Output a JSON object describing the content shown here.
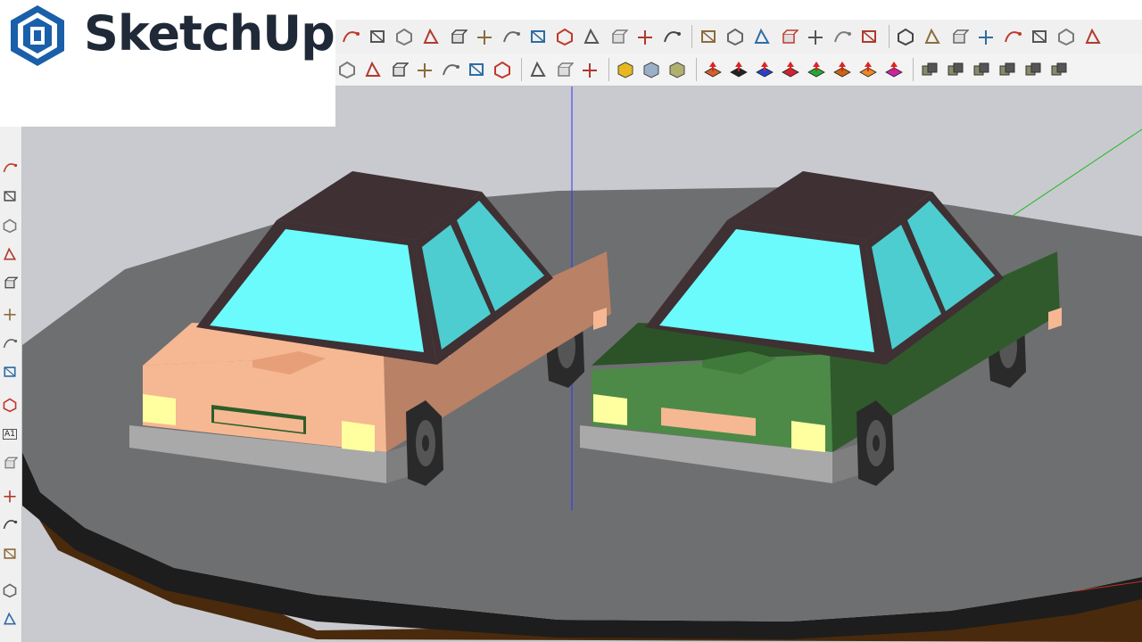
{
  "brand": {
    "name": "SketchUp"
  },
  "toolbars": {
    "top_row_icons": [
      "freehand-icon",
      "polygon-icon",
      "arc-icon",
      "push-pull-icon",
      "follow-me-icon",
      "offset-icon",
      "line-icon",
      "fillet-icon",
      "chamfer-icon",
      "extrude-icon",
      "building-icon",
      "pyramid-icon",
      "array-icon",
      "grid-icon",
      "hand-icon",
      "shape-icon",
      "flip-icon",
      "layers-icon",
      "knife-icon",
      "split-icon",
      "join-icon",
      "sweep-icon",
      "cylinder-icon",
      "bend-icon",
      "box-icon",
      "note-icon",
      "mesh-icon",
      "hatch-icon"
    ],
    "bottom_row_icons": [
      "camera-icon",
      "component-icon",
      "make-component-icon",
      "grass-icon",
      "erase-icon",
      "section-icon",
      "paint-icon",
      "grid-view-icon",
      "group-icon",
      "eye-icon",
      "solid-1-icon",
      "solid-2-icon",
      "solid-3-icon",
      "move-arrow-icon",
      "move-x-icon",
      "move-j-icon",
      "move-r-icon",
      "move-v-icon",
      "move-n-icon",
      "move-x2-icon",
      "move-f-icon",
      "boolean-1-icon",
      "boolean-2-icon",
      "boolean-3-icon",
      "boolean-4-icon",
      "boolean-5-icon",
      "boolean-6-icon"
    ],
    "badge_letters": [
      "=",
      "J",
      "R",
      "V",
      "N",
      "X",
      "F"
    ],
    "left_icons": [
      "curve-icon",
      "rect-icon",
      "circle-icon",
      "arc-tool-icon",
      "pie-icon",
      "push-icon",
      "rotate-icon",
      "follow-icon",
      "axes-icon",
      "text-icon",
      "3d-text-icon",
      "pan-icon",
      "zoom-icon",
      "zoom-extents-icon",
      "look-icon",
      "walk-icon"
    ],
    "left_text_label": "A1"
  },
  "scene": {
    "colors": {
      "sky": "#c9cacf",
      "ground": "#6e6f71",
      "ground_edge": "#1d1d1d",
      "ground_under": "#4a2a0c",
      "car1_body": "#f5b892",
      "car1_side": "#b98166",
      "car2_body": "#4d8a48",
      "car2_side": "#305a2c",
      "roof": "#3e3033",
      "glass": "#6bfbfd",
      "glass_side": "#4dcdd0",
      "headlight": "#ffffa0",
      "bumper": "#a9a9a9",
      "tire": "#2a2a2a",
      "axis_blue": "#3333ff",
      "axis_green": "#22bb22"
    }
  }
}
